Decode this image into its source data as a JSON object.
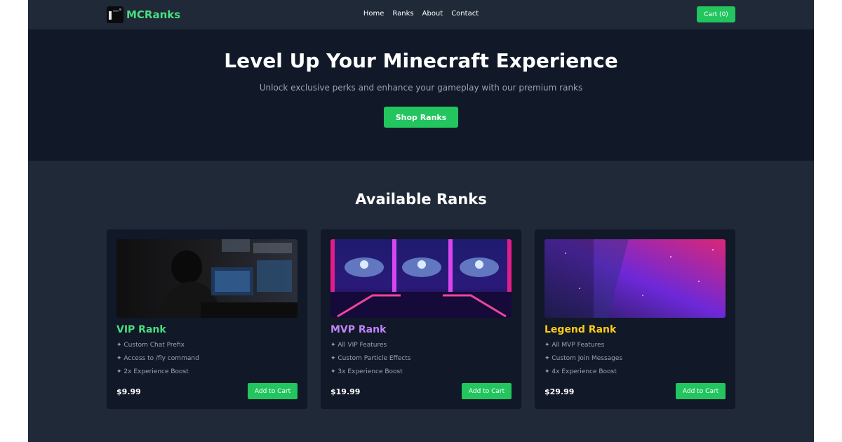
{
  "brand": {
    "name": "MCRanks",
    "icon": "cube-logo-icon"
  },
  "nav": {
    "links": [
      "Home",
      "Ranks",
      "About",
      "Contact"
    ],
    "cart_label": "Cart (0)"
  },
  "hero": {
    "title": "Level Up Your Minecraft Experience",
    "subtitle": "Unlock exclusive perks and enhance your gameplay with our premium ranks",
    "cta_label": "Shop Ranks"
  },
  "ranks": {
    "title": "Available Ranks",
    "items": [
      {
        "name": "VIP Rank",
        "color": "#4ade80",
        "features": [
          "✦ Custom Chat Prefix",
          "✦ Access to /fly command",
          "✦ 2x Experience Boost"
        ],
        "price": "$9.99",
        "button": "Add to Cart",
        "image": "gamer-at-desk-photo"
      },
      {
        "name": "MVP Rank",
        "color": "#c084fc",
        "features": [
          "✦ All VIP Features",
          "✦ Custom Particle Effects",
          "✦ 3x Experience Boost"
        ],
        "price": "$19.99",
        "button": "Add to Cart",
        "image": "neon-arcade-machines-photo"
      },
      {
        "name": "Legend Rank",
        "color": "#facc15",
        "features": [
          "✦ All MVP Features",
          "✦ Custom Join Messages",
          "✦ 4x Experience Boost"
        ],
        "price": "$29.99",
        "button": "Add to Cart",
        "image": "purple-nebula-rain-photo"
      }
    ]
  },
  "colors": {
    "accent": "#22c55e",
    "hero_bg": "#111827",
    "page_bg": "#1f2937"
  }
}
